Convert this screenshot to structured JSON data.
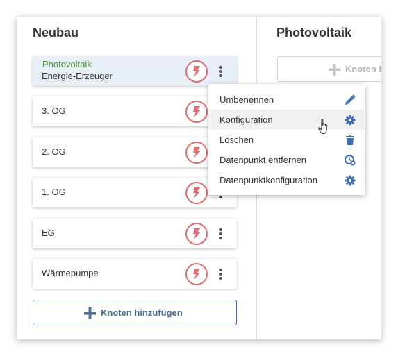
{
  "left_column": {
    "title": "Neubau",
    "nodes": [
      {
        "name": "Energie-Erzeuger",
        "subtitle": "Photovoltaik",
        "selected": true
      },
      {
        "name": "3. OG"
      },
      {
        "name": "2. OG"
      },
      {
        "name": "1. OG"
      },
      {
        "name": "EG"
      },
      {
        "name": "Wärmepumpe"
      }
    ],
    "add_button_label": "Knoten hinzufügen"
  },
  "right_column": {
    "title": "Photovoltaik",
    "add_button_label": "Knoten hinzufügen"
  },
  "context_menu": {
    "items": [
      {
        "label": "Umbenennen",
        "icon": "pencil-icon"
      },
      {
        "label": "Konfiguration",
        "icon": "gear-icon",
        "hovered": true
      },
      {
        "label": "Löschen",
        "icon": "trash-icon"
      },
      {
        "label": "Datenpunkt entfernen",
        "icon": "datapoint-remove-icon"
      },
      {
        "label": "Datenpunktkonfiguration",
        "icon": "gear-icon"
      }
    ]
  },
  "colors": {
    "accent": "#4b6a94",
    "icon_blue": "#3f6fb5",
    "bolt_red": "#e36b6b",
    "subtitle_green": "#4a8f3b",
    "selected_bg": "#e8eff7"
  }
}
